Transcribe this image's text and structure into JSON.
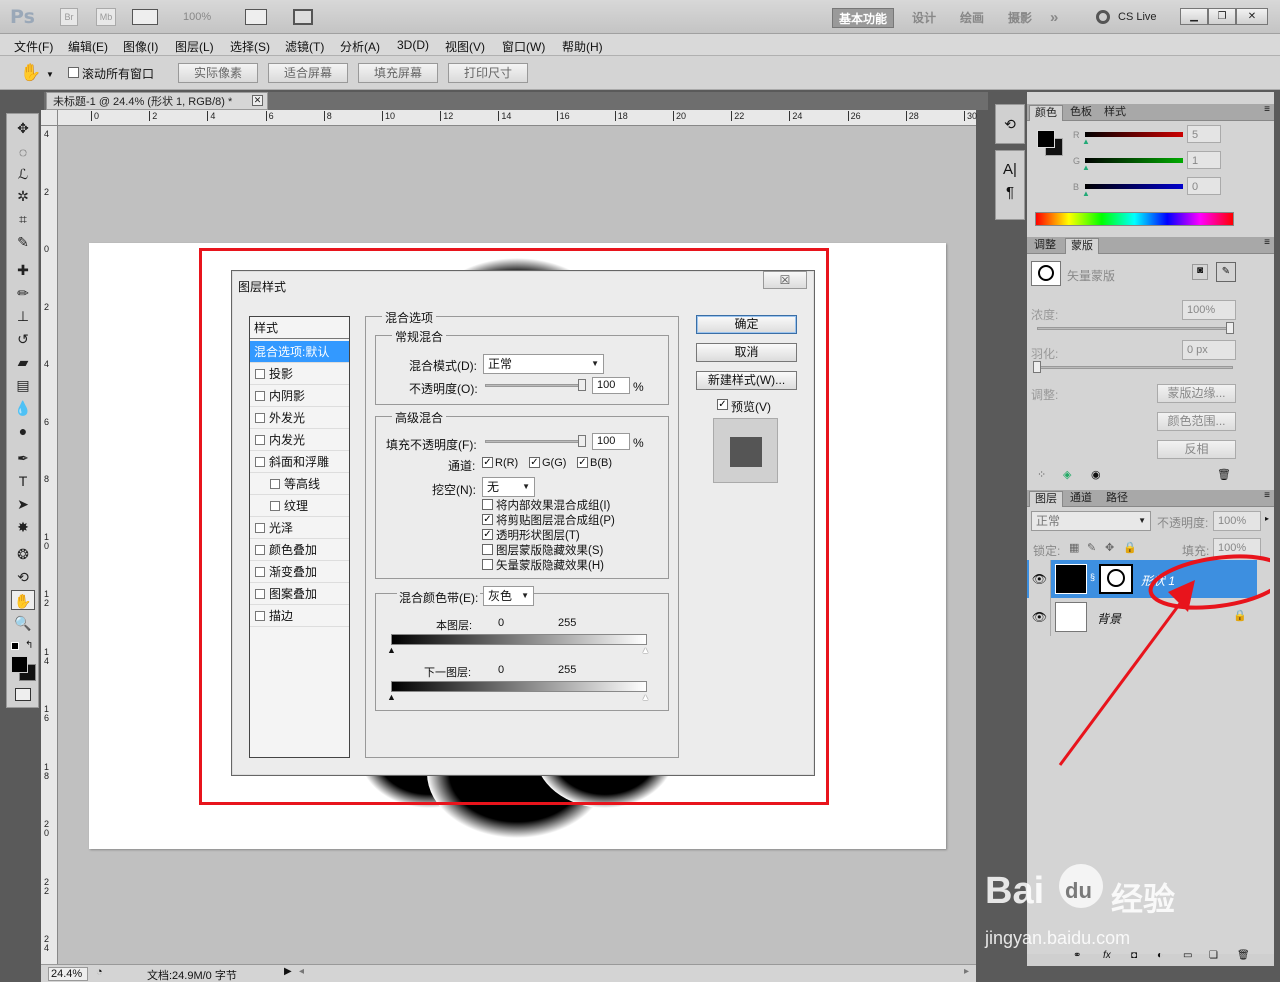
{
  "app": {
    "logo": "Ps",
    "bridge_btn": "Br",
    "minibridge_btn": "Mb",
    "zoom": "100%",
    "workspaces": [
      "基本功能",
      "设计",
      "绘画",
      "摄影"
    ],
    "more": "»",
    "cslive": "CS Live"
  },
  "menu": [
    "文件(F)",
    "编辑(E)",
    "图像(I)",
    "图层(L)",
    "选择(S)",
    "滤镜(T)",
    "分析(A)",
    "3D(D)",
    "视图(V)",
    "窗口(W)",
    "帮助(H)"
  ],
  "options": {
    "scroll_all": "滚动所有窗口",
    "buttons": [
      "实际像素",
      "适合屏幕",
      "填充屏幕",
      "打印尺寸"
    ]
  },
  "document": {
    "tab_title": "未标题-1 @ 24.4% (形状 1, RGB/8) *",
    "ruler_h": [
      "0",
      "2",
      "4",
      "6",
      "8",
      "10",
      "12",
      "14",
      "16",
      "18",
      "20",
      "22",
      "24",
      "26",
      "28",
      "30"
    ],
    "ruler_v": [
      "4",
      "2",
      "0",
      "2",
      "4",
      "6",
      "8",
      "1\n0",
      "1\n2",
      "1\n4",
      "1\n6",
      "1\n8",
      "2\n0",
      "2\n2",
      "2\n4"
    ],
    "zoom": "24.4%",
    "doc_info": "文档:24.9M/0 字节"
  },
  "dialog": {
    "title": "图层样式",
    "close": "☒",
    "styles_header": "样式",
    "styles": [
      {
        "label": "混合选项:默认",
        "selected": true,
        "checkbox": false,
        "indent": false
      },
      {
        "label": "投影",
        "selected": false,
        "checkbox": true,
        "indent": false
      },
      {
        "label": "内阴影",
        "selected": false,
        "checkbox": true,
        "indent": false
      },
      {
        "label": "外发光",
        "selected": false,
        "checkbox": true,
        "indent": false
      },
      {
        "label": "内发光",
        "selected": false,
        "checkbox": true,
        "indent": false
      },
      {
        "label": "斜面和浮雕",
        "selected": false,
        "checkbox": true,
        "indent": false
      },
      {
        "label": "等高线",
        "selected": false,
        "checkbox": true,
        "indent": true
      },
      {
        "label": "纹理",
        "selected": false,
        "checkbox": true,
        "indent": true
      },
      {
        "label": "光泽",
        "selected": false,
        "checkbox": true,
        "indent": false
      },
      {
        "label": "颜色叠加",
        "selected": false,
        "checkbox": true,
        "indent": false
      },
      {
        "label": "渐变叠加",
        "selected": false,
        "checkbox": true,
        "indent": false
      },
      {
        "label": "图案叠加",
        "selected": false,
        "checkbox": true,
        "indent": false
      },
      {
        "label": "描边",
        "selected": false,
        "checkbox": true,
        "indent": false
      }
    ],
    "blend_options": "混合选项",
    "general_blend": "常规混合",
    "blend_mode_label": "混合模式(D):",
    "blend_mode_value": "正常",
    "opacity_label": "不透明度(O):",
    "opacity_value": "100",
    "percent": "%",
    "advanced_blend": "高级混合",
    "fill_opacity_label": "填充不透明度(F):",
    "fill_opacity_value": "100",
    "channels_label": "通道:",
    "channels": [
      "R(R)",
      "G(G)",
      "B(B)"
    ],
    "knockout_label": "挖空(N):",
    "knockout_value": "无",
    "advanced_options": [
      {
        "label": "将内部效果混合成组(I)",
        "checked": false
      },
      {
        "label": "将剪贴图层混合成组(P)",
        "checked": true
      },
      {
        "label": "透明形状图层(T)",
        "checked": true
      },
      {
        "label": "图层蒙版隐藏效果(S)",
        "checked": false
      },
      {
        "label": "矢量蒙版隐藏效果(H)",
        "checked": false
      }
    ],
    "blend_if_label": "混合颜色带(E):",
    "blend_if_value": "灰色",
    "this_layer_label": "本图层:",
    "underlying_label": "下一图层:",
    "range_min": "0",
    "range_max": "255",
    "ok": "确定",
    "cancel": "取消",
    "new_style": "新建样式(W)...",
    "preview": "预览(V)"
  },
  "color_panel": {
    "tabs": [
      "颜色",
      "色板",
      "样式"
    ],
    "channels": [
      {
        "name": "R",
        "value": "5",
        "color": "#cc0000"
      },
      {
        "name": "G",
        "value": "1",
        "color": "#00aa00"
      },
      {
        "name": "B",
        "value": "0",
        "color": "#0000cc"
      }
    ]
  },
  "masks_panel": {
    "tabs": [
      "调整",
      "蒙版"
    ],
    "mask_name": "矢量蒙版",
    "density_label": "浓度:",
    "density_value": "100%",
    "feather_label": "羽化:",
    "feather_value": "0 px",
    "refine_label": "调整:",
    "buttons": [
      "蒙版边缘...",
      "颜色范围...",
      "反相"
    ]
  },
  "layers_panel": {
    "tabs": [
      "图层",
      "通道",
      "路径"
    ],
    "blend_mode": "正常",
    "opacity_label": "不透明度:",
    "opacity_value": "100%",
    "lock_label": "锁定:",
    "fill_label": "填充:",
    "fill_value": "100%",
    "layers": [
      {
        "name": "形状 1",
        "selected": true
      },
      {
        "name": "背景",
        "selected": false
      }
    ]
  },
  "watermark": {
    "line1": "Bai",
    "line1b": "du",
    "line1c": "经验",
    "line2": "jingyan.baidu.com"
  },
  "annotation_color": "#e8141c"
}
